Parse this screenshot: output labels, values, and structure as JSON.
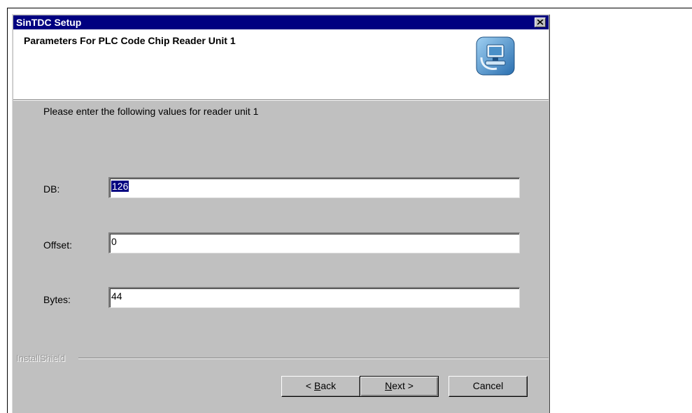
{
  "window": {
    "title": "SinTDC Setup"
  },
  "header": {
    "title": "Parameters For PLC Code Chip Reader Unit 1"
  },
  "instruction": "Please enter the following values for reader unit 1",
  "fields": [
    {
      "label": "DB:",
      "value": "126"
    },
    {
      "label": "Offset:",
      "value": "0"
    },
    {
      "label": "Bytes:",
      "value": "44"
    }
  ],
  "brand": "InstallShield",
  "buttons": {
    "back": {
      "prefix": "< ",
      "mnemonic": "B",
      "rest": "ack"
    },
    "next": {
      "mnemonic": "N",
      "rest": "ext >"
    },
    "cancel": "Cancel"
  },
  "colors": {
    "titlebar": "#000080",
    "dialog": "#c0c0c0",
    "selection": "#000080"
  }
}
